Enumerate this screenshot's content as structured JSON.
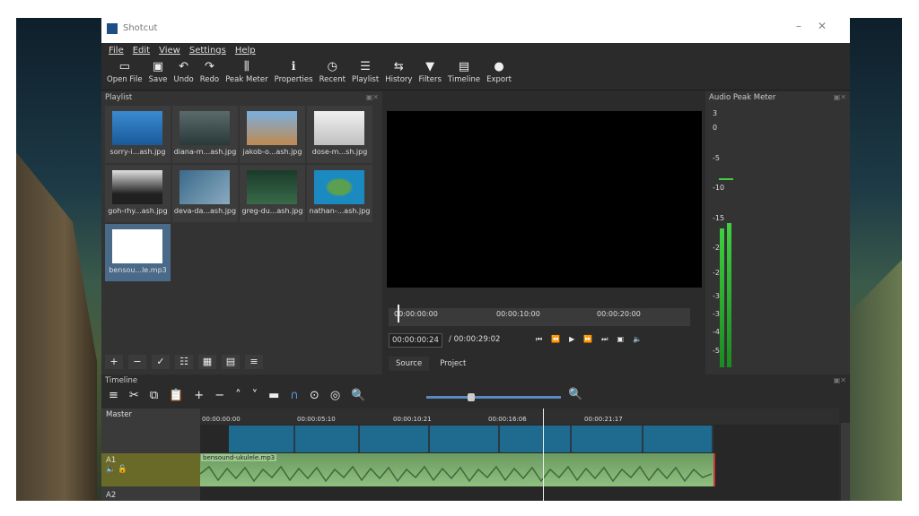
{
  "window": {
    "title": "Shotcut"
  },
  "menu": [
    "File",
    "Edit",
    "View",
    "Settings",
    "Help"
  ],
  "toolbar": [
    {
      "label": "Open File",
      "icon": "folder-icon"
    },
    {
      "label": "Save",
      "icon": "save-icon"
    },
    {
      "label": "Undo",
      "icon": "undo-icon"
    },
    {
      "label": "Redo",
      "icon": "redo-icon"
    },
    {
      "label": "Peak Meter",
      "icon": "peak-meter-icon"
    },
    {
      "label": "Properties",
      "icon": "info-icon"
    },
    {
      "label": "Recent",
      "icon": "clock-icon"
    },
    {
      "label": "Playlist",
      "icon": "list-icon"
    },
    {
      "label": "History",
      "icon": "history-icon"
    },
    {
      "label": "Filters",
      "icon": "filter-icon"
    },
    {
      "label": "Timeline",
      "icon": "timeline-icon"
    },
    {
      "label": "Export",
      "icon": "export-icon"
    }
  ],
  "playlist": {
    "title": "Playlist",
    "items": [
      "sorry-i...ash.jpg",
      "diana-m...ash.jpg",
      "jakob-o...ash.jpg",
      "dose-m...sh.jpg",
      "goh-rhy...ash.jpg",
      "deva-da...ash.jpg",
      "greg-du...ash.jpg",
      "nathan-...ash.jpg",
      "bensou...le.mp3"
    ]
  },
  "viewer": {
    "ruler": [
      "00:00:00:00",
      "00:00:10:00",
      "00:00:20:00"
    ],
    "current": "00:00:00:24",
    "total": "/ 00:00:29:02",
    "tabs": [
      "Source",
      "Project"
    ]
  },
  "meter": {
    "title": "Audio Peak Meter",
    "scale": [
      "3",
      "0",
      "-5",
      "-10",
      "-15",
      "-20",
      "-25",
      "-30",
      "-35",
      "-40",
      "-50"
    ],
    "left_level_db": -14,
    "right_level_db": -12
  },
  "timeline": {
    "title": "Timeline",
    "tracks": [
      "Master",
      "A1",
      "A2"
    ],
    "ruler": [
      "00:00:00:00",
      "00:00:05:10",
      "00:00:10:21",
      "00:00:16:06",
      "00:00:21:17"
    ],
    "audio_clip": "bensound-ukulele.mp3"
  }
}
